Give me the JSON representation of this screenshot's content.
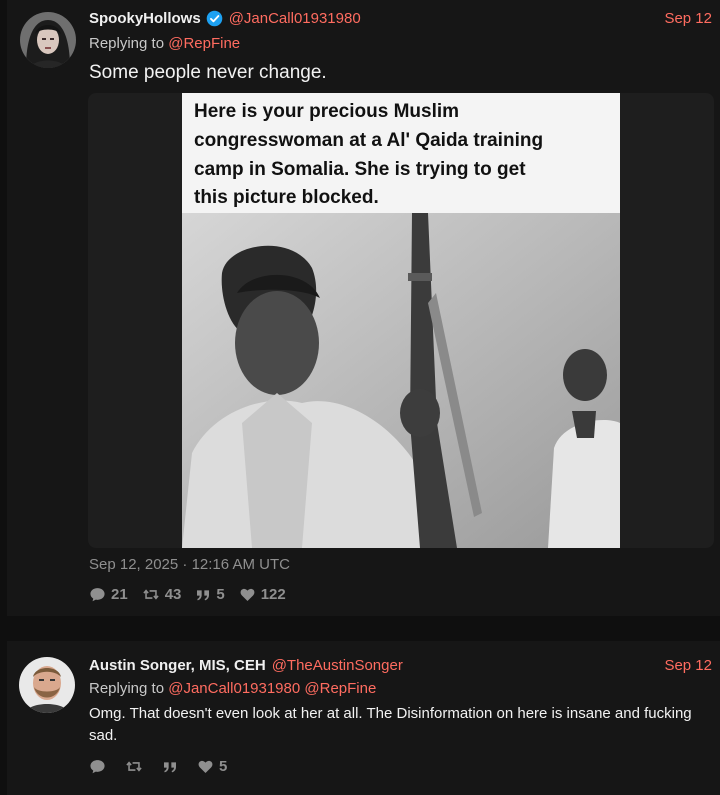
{
  "tweets": [
    {
      "fullname": "SpookyHollows",
      "handle": "@JanCall01931980",
      "date": "Sep 12",
      "replying_label": "Replying to",
      "replying_to": [
        "@RepFine"
      ],
      "text": "Some people never change.",
      "media_caption": "Here is your precious Muslim congresswoman at a Al' Qaida training camp in Somalia. She is trying to get this picture blocked.",
      "media_caption_lines": [
        "Here is your precious Muslim",
        "congresswoman at a Al' Qaida training",
        "camp in Somalia. She is trying to get",
        "this picture blocked."
      ],
      "published": "Sep 12, 2025 · 12:16 AM UTC",
      "stats": {
        "replies": "21",
        "retweets": "43",
        "quotes": "5",
        "likes": "122"
      },
      "verified": true
    },
    {
      "fullname": "Austin Songer, MIS, CEH",
      "handle": "@TheAustinSonger",
      "date": "Sep 12",
      "replying_label": "Replying to",
      "replying_to": [
        "@JanCall01931980",
        "@RepFine"
      ],
      "text": "Omg. That doesn't even look at her at all. The Disinformation on here is insane and fucking sad.",
      "stats": {
        "replies": "",
        "retweets": "",
        "quotes": "",
        "likes": "5"
      }
    }
  ],
  "colors": {
    "accent": "#ff6c60",
    "background": "#0f0f0f",
    "card": "#161616",
    "muted": "#8f8f8f",
    "verified": "#1da1f2"
  },
  "icons": [
    "verified-badge-icon",
    "comment-icon",
    "retweet-icon",
    "quote-icon",
    "heart-icon"
  ]
}
